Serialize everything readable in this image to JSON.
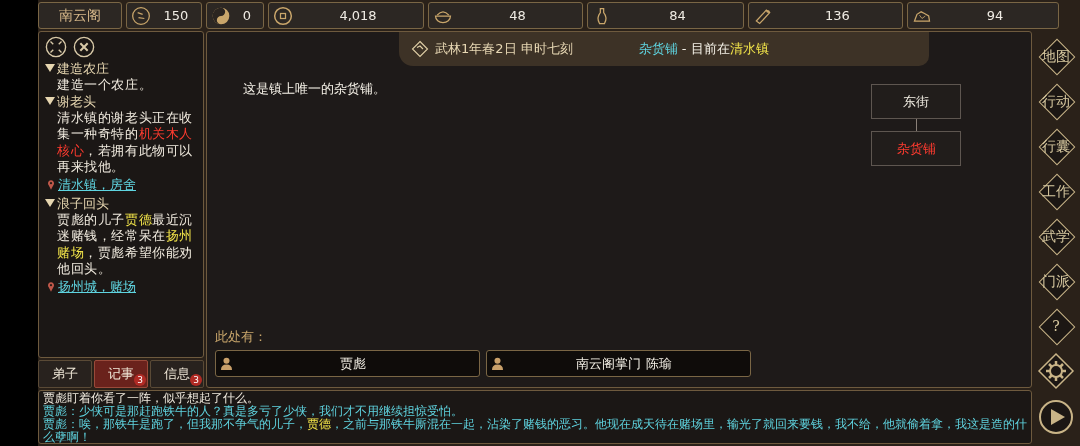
{
  "sect_button": "南云阁",
  "stats": [
    {
      "kind": "reputation",
      "value": "150"
    },
    {
      "kind": "yinyang",
      "value": "0"
    },
    {
      "kind": "coin",
      "value": "4,018"
    },
    {
      "kind": "food",
      "value": "48"
    },
    {
      "kind": "herb",
      "value": "84"
    },
    {
      "kind": "wood",
      "value": "136"
    },
    {
      "kind": "ore",
      "value": "94"
    }
  ],
  "quests": [
    {
      "title": "建造农庄",
      "expanded": true,
      "description": [
        {
          "kind": "normal",
          "text": "建造一个农庄。"
        }
      ]
    },
    {
      "title": "谢老头",
      "expanded": true,
      "description": [
        {
          "kind": "normal",
          "text": "清水镇的谢老头正在收集一种奇特的"
        },
        {
          "kind": "item",
          "text": "机关木人核心"
        },
        {
          "kind": "normal",
          "text": "，若拥有此物可以再来找他。"
        }
      ],
      "location": "清水镇，房舍"
    },
    {
      "title": "浪子回头",
      "expanded": true,
      "description": [
        {
          "kind": "normal",
          "text": "贾彪的儿子"
        },
        {
          "kind": "name",
          "text": "贾德"
        },
        {
          "kind": "normal",
          "text": "最近沉迷赌钱，经常呆在"
        },
        {
          "kind": "name",
          "text": "扬州赌场"
        },
        {
          "kind": "normal",
          "text": "，贾彪希望你能劝他回头。"
        }
      ],
      "location": "扬州城，赌场"
    }
  ],
  "left_tabs": [
    {
      "label": "弟子",
      "selected": false
    },
    {
      "label": "记事",
      "selected": true,
      "badge": "3"
    },
    {
      "label": "信息",
      "selected": false,
      "badge": "3"
    }
  ],
  "header": {
    "date": "武林1年春2日 申时七刻",
    "place": "杂货铺",
    "separator": " - 目前在",
    "town": "清水镇"
  },
  "description": "这是镇上唯一的杂货铺。",
  "map_nodes": [
    {
      "label": "东街",
      "current": false
    },
    {
      "label": "杂货铺",
      "current": true
    }
  ],
  "here_label": "此处有：",
  "npcs": [
    "贾彪",
    "南云阁掌门 陈瑜"
  ],
  "side_menu": [
    {
      "kind": "text",
      "label": "地图"
    },
    {
      "kind": "text",
      "label": "行动"
    },
    {
      "kind": "text",
      "label": "行囊"
    },
    {
      "kind": "text",
      "label": "工作"
    },
    {
      "kind": "text",
      "label": "武学"
    },
    {
      "kind": "text",
      "label": "门派"
    },
    {
      "kind": "text",
      "label": "?"
    },
    {
      "kind": "gear"
    }
  ],
  "log": [
    [
      {
        "kind": "narration",
        "text": "贾彪盯着你看了一阵，似乎想起了什么。"
      }
    ],
    [
      {
        "kind": "speech",
        "text": "贾彪：少侠可是那赶跑铁牛的人？真是多亏了少侠，我们才不用继续担惊受怕。"
      }
    ],
    [
      {
        "kind": "speech",
        "text": "贾彪：唉，那铁牛是跑了，但我那不争气的儿子，"
      },
      {
        "kind": "name",
        "text": "贾德"
      },
      {
        "kind": "speech",
        "text": "，之前与那铁牛厮混在一起，沾染了赌钱的恶习。他现在成天待在赌场里，输光了就回来要钱，我不给，他就偷着拿，我这是造的什么孽啊！"
      }
    ]
  ]
}
